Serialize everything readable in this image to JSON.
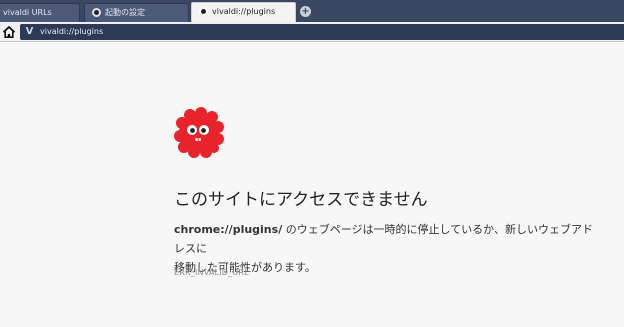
{
  "tabs": [
    {
      "label": "vivaldi URLs",
      "active": false
    },
    {
      "label": "起動の設定",
      "active": false
    },
    {
      "label": "vivaldi://plugins",
      "active": true
    }
  ],
  "new_tab_label": "+",
  "address_bar": {
    "browser_icon": "vivaldi-v-icon",
    "url": "vivaldi://plugins"
  },
  "error_page": {
    "illustration": "red-blob-monster",
    "title": "このサイトにアクセスできません",
    "description_url": "chrome://plugins/",
    "description_line1": " のウェブページは一時的に停止しているか、新しいウェブアドレスに",
    "description_line2": "移動した可能性があります。",
    "error_code": "ERR_INVALID_URL"
  },
  "colors": {
    "tabbar": "#3a4763",
    "urlfield": "#2d3a55",
    "page_background": "#f7f7f7",
    "monster_red": "#e8232c"
  }
}
